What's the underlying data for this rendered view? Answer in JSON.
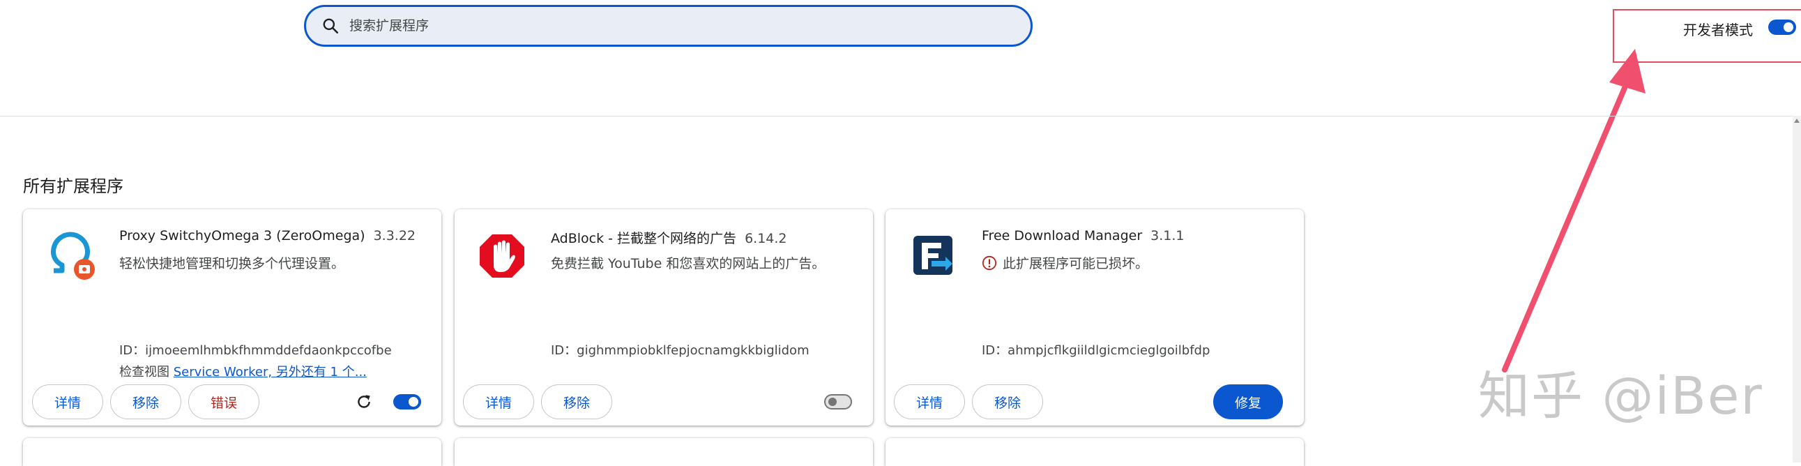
{
  "search": {
    "placeholder": "搜索扩展程序",
    "icon": "search-icon"
  },
  "dev_mode": {
    "label": "开发者模式",
    "enabled": true
  },
  "section_title": "所有扩展程序",
  "cards": [
    {
      "name": "Proxy SwitchyOmega 3 (ZeroOmega)",
      "version": "3.3.22",
      "description": "轻松快捷地管理和切换多个代理设置。",
      "id_line": "ID：ijmoeemlhmbkfhmmddefdaonkpccofbe",
      "inspect_label": "检查视图",
      "inspect_link": "Service Worker, 另外还有 1 个...",
      "buttons": {
        "details": "详情",
        "remove": "移除",
        "errors": "错误"
      },
      "enabled": true,
      "icon": "omega-icon"
    },
    {
      "name": "AdBlock - 拦截整个网络的广告",
      "version": "6.14.2",
      "description": "免费拦截 YouTube 和您喜欢的网站上的广告。",
      "id_line": "ID：gighmmpiobklfepjocnamgkkbiglidom",
      "buttons": {
        "details": "详情",
        "remove": "移除"
      },
      "enabled": false,
      "icon": "adblock-hand-icon"
    },
    {
      "name": "Free Download Manager",
      "version": "3.1.1",
      "description": "此扩展程序可能已损坏。",
      "id_line": "ID：ahmpjcflkgiildlgicmcieglgoilbfdp",
      "buttons": {
        "details": "详情",
        "remove": "移除",
        "repair": "修复"
      },
      "icon": "fdm-icon",
      "warning_icon": "warning-icon"
    }
  ],
  "watermark": "知乎 @iBer",
  "colors": {
    "accent": "#0b57d0",
    "error": "#b3261e",
    "annotation": "#e84a5f"
  }
}
